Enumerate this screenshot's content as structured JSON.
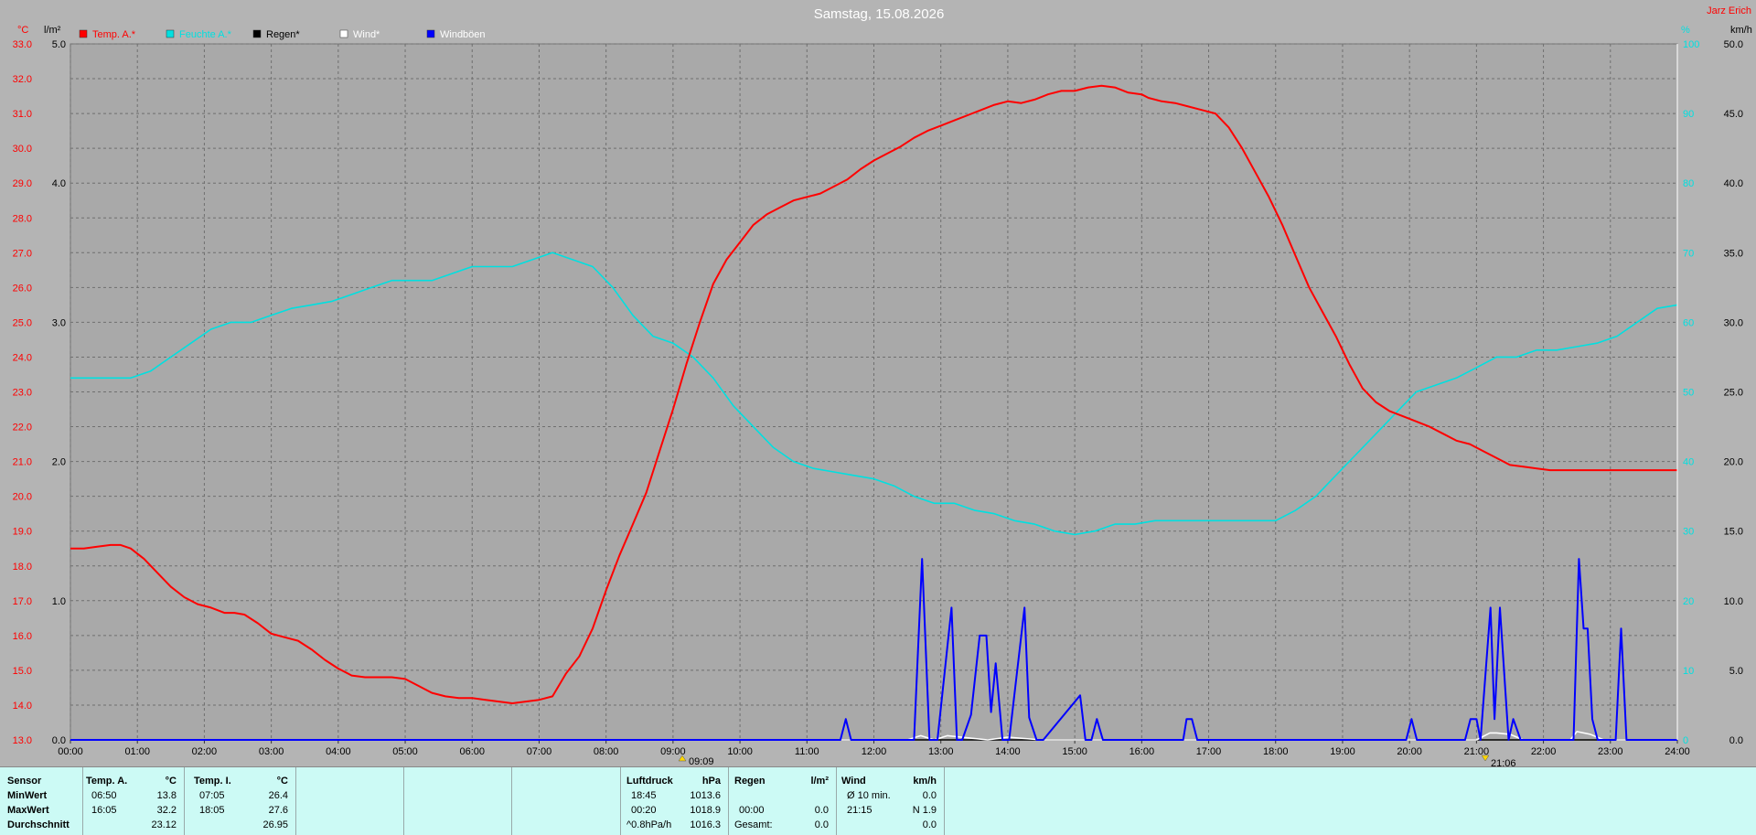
{
  "title": "Samstag, 15.08.2026",
  "user": "Jarz Erich",
  "units": {
    "left_outer": "°C",
    "left_inner": "l/m²",
    "right_inner": "%",
    "right_outer": "km/h"
  },
  "legend": [
    {
      "label": "Temp. A.*",
      "color": "#ff0000",
      "text_color": "#ff0000"
    },
    {
      "label": "Feuchte A.*",
      "color": "#00e0e0",
      "text_color": "#00e0e0"
    },
    {
      "label": "Regen*",
      "color": "#000000",
      "text_color": "#000000"
    },
    {
      "label": "Wind*",
      "color": "#ffffff",
      "text_color": "#ffffff"
    },
    {
      "label": "Windböen",
      "color": "#0000ff",
      "text_color": "#ffffff"
    }
  ],
  "axis_labels": {
    "temp": [
      "13.0",
      "14.0",
      "15.0",
      "16.0",
      "17.0",
      "18.0",
      "19.0",
      "20.0",
      "21.0",
      "22.0",
      "23.0",
      "24.0",
      "25.0",
      "26.0",
      "27.0",
      "28.0",
      "29.0",
      "30.0",
      "31.0",
      "32.0",
      "33.0"
    ],
    "rain": [
      "0.0",
      "1.0",
      "2.0",
      "3.0",
      "4.0",
      "5.0"
    ],
    "humidity": [
      "0",
      "10",
      "20",
      "30",
      "40",
      "50",
      "60",
      "70",
      "80",
      "90",
      "100"
    ],
    "wind": [
      "0.0",
      "5.0",
      "10.0",
      "15.0",
      "20.0",
      "25.0",
      "30.0",
      "35.0",
      "40.0",
      "45.0",
      "50.0"
    ],
    "time": [
      "00:00",
      "01:00",
      "02:00",
      "03:00",
      "04:00",
      "05:00",
      "06:00",
      "07:00",
      "08:00",
      "09:00",
      "10:00",
      "11:00",
      "12:00",
      "13:00",
      "14:00",
      "15:00",
      "16:00",
      "17:00",
      "18:00",
      "19:00",
      "20:00",
      "21:00",
      "22:00",
      "23:00",
      "24:00"
    ]
  },
  "sun_markers": {
    "sunrise": "09:09",
    "sunset": "21:06"
  },
  "chart_data": {
    "type": "line",
    "title": "Samstag, 15.08.2026",
    "x_unit": "hours",
    "xlim": [
      0,
      24
    ],
    "axes": {
      "temp": {
        "unit": "°C",
        "range": [
          13,
          33
        ]
      },
      "rain": {
        "unit": "l/m²",
        "range": [
          0,
          5
        ]
      },
      "humidity": {
        "unit": "%",
        "range": [
          0,
          100
        ]
      },
      "wind": {
        "unit": "km/h",
        "range": [
          0,
          50
        ]
      }
    },
    "grid": true,
    "legend_position": "top-left",
    "series": [
      {
        "name": "Temp. A.*",
        "axis": "temp",
        "color": "#ff0000",
        "x": [
          0,
          0.2,
          0.4,
          0.6,
          0.75,
          0.9,
          1.1,
          1.3,
          1.5,
          1.7,
          1.9,
          2.1,
          2.3,
          2.45,
          2.6,
          2.8,
          3.0,
          3.2,
          3.4,
          3.6,
          3.8,
          4.0,
          4.2,
          4.4,
          4.6,
          4.8,
          5.0,
          5.2,
          5.4,
          5.6,
          5.8,
          6.0,
          6.2,
          6.4,
          6.6,
          6.8,
          7.0,
          7.2,
          7.4,
          7.6,
          7.8,
          8.0,
          8.2,
          8.4,
          8.6,
          8.8,
          9.0,
          9.2,
          9.4,
          9.6,
          9.8,
          10.0,
          10.2,
          10.4,
          10.6,
          10.8,
          11.0,
          11.2,
          11.4,
          11.6,
          11.8,
          12.0,
          12.2,
          12.4,
          12.6,
          12.8,
          13.0,
          13.2,
          13.4,
          13.6,
          13.8,
          14.0,
          14.2,
          14.4,
          14.6,
          14.8,
          15.0,
          15.2,
          15.4,
          15.6,
          15.8,
          16.0,
          16.1,
          16.3,
          16.5,
          16.7,
          16.9,
          17.1,
          17.3,
          17.5,
          17.7,
          17.9,
          18.1,
          18.3,
          18.5,
          18.7,
          18.9,
          19.1,
          19.3,
          19.5,
          19.7,
          19.9,
          20.1,
          20.3,
          20.5,
          20.7,
          20.9,
          21.1,
          21.3,
          21.5,
          21.7,
          21.9,
          22.1,
          22.3,
          22.5,
          22.7,
          22.9,
          23.1,
          23.3,
          23.5,
          23.7,
          23.9,
          24.0
        ],
        "y": [
          18.5,
          18.5,
          18.55,
          18.6,
          18.6,
          18.5,
          18.2,
          17.8,
          17.4,
          17.1,
          16.9,
          16.8,
          16.65,
          16.65,
          16.6,
          16.35,
          16.05,
          15.95,
          15.85,
          15.6,
          15.3,
          15.05,
          14.85,
          14.8,
          14.8,
          14.8,
          14.75,
          14.55,
          14.35,
          14.25,
          14.2,
          14.2,
          14.15,
          14.1,
          14.05,
          14.1,
          14.15,
          14.25,
          14.9,
          15.4,
          16.2,
          17.3,
          18.3,
          19.2,
          20.1,
          21.3,
          22.5,
          23.8,
          25.0,
          26.1,
          26.8,
          27.3,
          27.8,
          28.1,
          28.3,
          28.5,
          28.6,
          28.7,
          28.9,
          29.1,
          29.4,
          29.65,
          29.85,
          30.05,
          30.3,
          30.5,
          30.65,
          30.8,
          30.95,
          31.1,
          31.25,
          31.35,
          31.3,
          31.4,
          31.55,
          31.65,
          31.65,
          31.75,
          31.8,
          31.75,
          31.6,
          31.55,
          31.45,
          31.35,
          31.3,
          31.2,
          31.1,
          31.0,
          30.6,
          30.0,
          29.3,
          28.6,
          27.8,
          26.9,
          26.0,
          25.3,
          24.6,
          23.8,
          23.1,
          22.7,
          22.45,
          22.3,
          22.15,
          22.0,
          21.8,
          21.6,
          21.5,
          21.3,
          21.1,
          20.9,
          20.85,
          20.8,
          20.75,
          20.75,
          20.75,
          20.75,
          20.75,
          20.75,
          20.75,
          20.75,
          20.75,
          20.75,
          20.75
        ]
      },
      {
        "name": "Feuchte A.*",
        "axis": "humidity",
        "color": "#00e0e0",
        "x": [
          0,
          0.3,
          0.6,
          0.9,
          1.2,
          1.5,
          1.8,
          2.1,
          2.4,
          2.7,
          3.0,
          3.3,
          3.6,
          3.9,
          4.2,
          4.5,
          4.8,
          5.1,
          5.4,
          5.7,
          6.0,
          6.3,
          6.6,
          6.9,
          7.2,
          7.5,
          7.8,
          8.1,
          8.4,
          8.7,
          9.0,
          9.3,
          9.6,
          9.9,
          10.2,
          10.5,
          10.8,
          11.1,
          11.4,
          11.7,
          12.0,
          12.3,
          12.6,
          12.9,
          13.2,
          13.5,
          13.8,
          14.1,
          14.4,
          14.7,
          15.0,
          15.3,
          15.6,
          15.9,
          16.2,
          16.5,
          16.8,
          17.1,
          17.4,
          17.7,
          18.0,
          18.3,
          18.6,
          18.9,
          19.2,
          19.5,
          19.8,
          20.1,
          20.4,
          20.7,
          21.0,
          21.3,
          21.6,
          21.9,
          22.2,
          22.5,
          22.8,
          23.1,
          23.4,
          23.7,
          24.0
        ],
        "y": [
          52,
          52,
          52,
          52,
          53,
          55,
          57,
          59,
          60,
          60,
          61,
          62,
          62.5,
          63,
          64,
          65,
          66,
          66,
          66,
          67,
          68,
          68,
          68,
          69,
          70,
          69,
          68,
          65,
          61,
          58,
          57,
          55,
          52,
          48,
          45,
          42,
          40,
          39,
          38.5,
          38,
          37.5,
          36.5,
          35,
          34,
          34,
          33,
          32.5,
          31.5,
          31,
          30,
          29.5,
          30,
          31,
          31,
          31.5,
          31.5,
          31.5,
          31.5,
          31.5,
          31.5,
          31.5,
          33,
          35,
          38,
          41,
          44,
          47,
          50,
          51,
          52,
          53.5,
          55,
          55,
          56,
          56,
          56.5,
          57,
          58,
          60,
          62,
          62.5
        ]
      },
      {
        "name": "Regen*",
        "axis": "rain",
        "color": "#000000",
        "x": [
          0,
          24
        ],
        "y": [
          0,
          0
        ]
      },
      {
        "name": "Wind*",
        "axis": "wind",
        "color": "#ffffff",
        "x": [
          0,
          12.5,
          12.7,
          12.9,
          13.1,
          13.7,
          14.0,
          14.5,
          15.0,
          16.5,
          17.0,
          21.0,
          21.2,
          21.3,
          21.5,
          21.7,
          22.0,
          22.4,
          22.5,
          22.7,
          22.9,
          23.0,
          24.0
        ],
        "y": [
          0,
          0,
          0.3,
          0,
          0.3,
          0,
          0.2,
          0,
          0,
          0,
          0,
          0,
          0.5,
          0.5,
          0.4,
          0,
          0,
          0,
          0.6,
          0.4,
          0,
          0,
          0
        ]
      },
      {
        "name": "Windböen",
        "axis": "wind",
        "color": "#0000ff",
        "x": [
          0,
          11.5,
          11.58,
          11.66,
          11.75,
          12.58,
          12.6,
          12.72,
          12.83,
          12.95,
          13.16,
          13.24,
          13.32,
          13.45,
          13.58,
          13.68,
          13.75,
          13.82,
          13.92,
          14.02,
          14.25,
          14.32,
          14.43,
          14.53,
          15.08,
          15.16,
          15.25,
          15.33,
          15.42,
          15.5,
          16.62,
          16.67,
          16.75,
          16.83,
          19.95,
          20.03,
          20.11,
          20.83,
          20.91,
          21.0,
          21.06,
          21.21,
          21.27,
          21.35,
          21.48,
          21.55,
          21.66,
          21.72,
          22.45,
          22.53,
          22.6,
          22.66,
          22.73,
          22.81,
          22.91,
          23.08,
          23.16,
          23.24,
          24.0
        ],
        "y": [
          0,
          0,
          1.5,
          0,
          0,
          0,
          0,
          13,
          0,
          0,
          9.5,
          0,
          0,
          1.8,
          7.5,
          7.5,
          2,
          5.5,
          0,
          0,
          9.5,
          1.6,
          0,
          0,
          3.2,
          0,
          0,
          1.5,
          0,
          0,
          0,
          1.5,
          1.5,
          0,
          0,
          1.5,
          0,
          0,
          1.5,
          1.5,
          0,
          9.5,
          1.5,
          9.5,
          0,
          1.5,
          0,
          0,
          0,
          13,
          8,
          8,
          1.5,
          0,
          0,
          0,
          8,
          0,
          0
        ]
      }
    ]
  },
  "summary": {
    "labels": [
      "Sensor",
      "MinWert",
      "MaxWert",
      "Durchschnitt"
    ],
    "temp_a": {
      "title": "Temp. A.",
      "unit": "°C",
      "min_time": "06:50",
      "min": "13.8",
      "max_time": "16:05",
      "max": "32.2",
      "avg": "23.12"
    },
    "temp_i": {
      "title": "Temp. I.",
      "unit": "°C",
      "min_time": "07:05",
      "min": "26.4",
      "max_time": "18:05",
      "max": "27.6",
      "avg": "26.95"
    },
    "pressure": {
      "title": "Luftdruck",
      "unit": "hPa",
      "r1_time": "18:45",
      "r1": "1013.6",
      "r2_time": "00:20",
      "r2": "1018.9",
      "r3_time": "^0.8hPa/h",
      "r3": "1016.3"
    },
    "rain": {
      "title": "Regen",
      "unit": "l/m²",
      "r2_time": "00:00",
      "r2": "0.0",
      "r3_time": "Gesamt:",
      "r3": "0.0"
    },
    "wind": {
      "title": "Wind",
      "unit": "km/h",
      "r1_time": "Ø 10 min.",
      "r1": "0.0",
      "r2_time": "21:15",
      "r2": "N 1.9",
      "r3": "0.0"
    }
  }
}
